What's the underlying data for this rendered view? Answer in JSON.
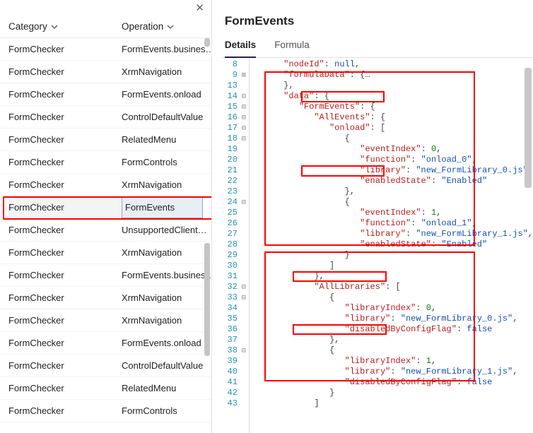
{
  "right_title": "FormEvents",
  "tabs": {
    "details": "Details",
    "formula": "Formula",
    "active": "details"
  },
  "headers": {
    "category": "Category",
    "operation": "Operation"
  },
  "rows": [
    {
      "cat": "FormChecker",
      "op": "FormEvents.busines…"
    },
    {
      "cat": "FormChecker",
      "op": "XrmNavigation"
    },
    {
      "cat": "FormChecker",
      "op": "FormEvents.onload"
    },
    {
      "cat": "FormChecker",
      "op": "ControlDefaultValue"
    },
    {
      "cat": "FormChecker",
      "op": "RelatedMenu"
    },
    {
      "cat": "FormChecker",
      "op": "FormControls"
    },
    {
      "cat": "FormChecker",
      "op": "XrmNavigation"
    },
    {
      "cat": "FormChecker",
      "op": "FormEvents",
      "selected": true
    },
    {
      "cat": "FormChecker",
      "op": "UnsupportedClient…"
    },
    {
      "cat": "FormChecker",
      "op": "XrmNavigation"
    },
    {
      "cat": "FormChecker",
      "op": "FormEvents.busines…"
    },
    {
      "cat": "FormChecker",
      "op": "XrmNavigation"
    },
    {
      "cat": "FormChecker",
      "op": "XrmNavigation"
    },
    {
      "cat": "FormChecker",
      "op": "FormEvents.onload"
    },
    {
      "cat": "FormChecker",
      "op": "ControlDefaultValue"
    },
    {
      "cat": "FormChecker",
      "op": "RelatedMenu"
    },
    {
      "cat": "FormChecker",
      "op": "FormControls"
    }
  ],
  "code_lines": [
    {
      "n": 8,
      "g": "",
      "indent": 2,
      "tokens": [
        [
          "k",
          "\"nodeId\""
        ],
        [
          "p",
          ": "
        ],
        [
          "nullv",
          "null"
        ],
        [
          "p",
          ","
        ]
      ]
    },
    {
      "n": 9,
      "g": "+",
      "indent": 2,
      "tokens": [
        [
          "k",
          "\"formulaData\""
        ],
        [
          "p",
          ": {"
        ],
        [
          "p",
          "…"
        ]
      ]
    },
    {
      "n": 13,
      "g": "",
      "indent": 2,
      "tokens": [
        [
          "p",
          "},"
        ]
      ]
    },
    {
      "n": 14,
      "g": "-",
      "indent": 2,
      "tokens": [
        [
          "k",
          "\"data\""
        ],
        [
          "p",
          ": {"
        ]
      ]
    },
    {
      "n": 15,
      "g": "-",
      "indent": 3,
      "tokens": [
        [
          "k",
          "\"FormEvents\""
        ],
        [
          "p",
          ": {"
        ]
      ]
    },
    {
      "n": 16,
      "g": "-",
      "indent": 4,
      "tokens": [
        [
          "k",
          "\"AllEvents\""
        ],
        [
          "p",
          ": {"
        ]
      ]
    },
    {
      "n": 17,
      "g": "-",
      "indent": 5,
      "tokens": [
        [
          "k",
          "\"onload\""
        ],
        [
          "p",
          ": ["
        ]
      ]
    },
    {
      "n": 18,
      "g": "-",
      "indent": 6,
      "tokens": [
        [
          "p",
          "{"
        ]
      ]
    },
    {
      "n": 19,
      "g": "",
      "indent": 7,
      "tokens": [
        [
          "k",
          "\"eventIndex\""
        ],
        [
          "p",
          ": "
        ],
        [
          "n",
          "0"
        ],
        [
          "p",
          ","
        ]
      ]
    },
    {
      "n": 20,
      "g": "",
      "indent": 7,
      "tokens": [
        [
          "k",
          "\"function\""
        ],
        [
          "p",
          ": "
        ],
        [
          "s",
          "\"onload_0\""
        ],
        [
          "p",
          ","
        ]
      ]
    },
    {
      "n": 21,
      "g": "",
      "indent": 7,
      "tokens": [
        [
          "k",
          "\"library\""
        ],
        [
          "p",
          ": "
        ],
        [
          "s",
          "\"new_FormLibrary_0.js\""
        ],
        [
          "p",
          ","
        ]
      ]
    },
    {
      "n": 22,
      "g": "",
      "indent": 7,
      "tokens": [
        [
          "k",
          "\"enabledState\""
        ],
        [
          "p",
          ": "
        ],
        [
          "s",
          "\"Enabled\""
        ]
      ]
    },
    {
      "n": 23,
      "g": "",
      "indent": 6,
      "tokens": [
        [
          "p",
          "},"
        ]
      ]
    },
    {
      "n": 24,
      "g": "-",
      "indent": 6,
      "tokens": [
        [
          "p",
          "{"
        ]
      ]
    },
    {
      "n": 25,
      "g": "",
      "indent": 7,
      "tokens": [
        [
          "k",
          "\"eventIndex\""
        ],
        [
          "p",
          ": "
        ],
        [
          "n",
          "1"
        ],
        [
          "p",
          ","
        ]
      ]
    },
    {
      "n": 26,
      "g": "",
      "indent": 7,
      "tokens": [
        [
          "k",
          "\"function\""
        ],
        [
          "p",
          ": "
        ],
        [
          "s",
          "\"onload_1\""
        ],
        [
          "p",
          ","
        ]
      ]
    },
    {
      "n": 27,
      "g": "",
      "indent": 7,
      "tokens": [
        [
          "k",
          "\"library\""
        ],
        [
          "p",
          ": "
        ],
        [
          "s",
          "\"new_FormLibrary_1.js\""
        ],
        [
          "p",
          ","
        ]
      ]
    },
    {
      "n": 28,
      "g": "",
      "indent": 7,
      "tokens": [
        [
          "k",
          "\"enabledState\""
        ],
        [
          "p",
          ": "
        ],
        [
          "s",
          "\"Enabled\""
        ]
      ]
    },
    {
      "n": 29,
      "g": "",
      "indent": 6,
      "tokens": [
        [
          "p",
          "}"
        ]
      ]
    },
    {
      "n": 30,
      "g": "",
      "indent": 5,
      "tokens": [
        [
          "p",
          "]"
        ]
      ]
    },
    {
      "n": 31,
      "g": "",
      "indent": 4,
      "tokens": [
        [
          "p",
          "},"
        ]
      ]
    },
    {
      "n": 32,
      "g": "-",
      "indent": 4,
      "tokens": [
        [
          "k",
          "\"AllLibraries\""
        ],
        [
          "p",
          ": ["
        ]
      ]
    },
    {
      "n": 33,
      "g": "-",
      "indent": 5,
      "tokens": [
        [
          "p",
          "{"
        ]
      ]
    },
    {
      "n": 34,
      "g": "",
      "indent": 6,
      "tokens": [
        [
          "k",
          "\"libraryIndex\""
        ],
        [
          "p",
          ": "
        ],
        [
          "n",
          "0"
        ],
        [
          "p",
          ","
        ]
      ]
    },
    {
      "n": 35,
      "g": "",
      "indent": 6,
      "tokens": [
        [
          "k",
          "\"library\""
        ],
        [
          "p",
          ": "
        ],
        [
          "s",
          "\"new_FormLibrary_0.js\""
        ],
        [
          "p",
          ","
        ]
      ]
    },
    {
      "n": 36,
      "g": "",
      "indent": 6,
      "tokens": [
        [
          "k",
          "\"disabledByConfigFlag\""
        ],
        [
          "p",
          ": "
        ],
        [
          "b",
          "false"
        ]
      ]
    },
    {
      "n": 37,
      "g": "",
      "indent": 5,
      "tokens": [
        [
          "p",
          "},"
        ]
      ]
    },
    {
      "n": 38,
      "g": "-",
      "indent": 5,
      "tokens": [
        [
          "p",
          "{"
        ]
      ]
    },
    {
      "n": 39,
      "g": "",
      "indent": 6,
      "tokens": [
        [
          "k",
          "\"libraryIndex\""
        ],
        [
          "p",
          ": "
        ],
        [
          "n",
          "1"
        ],
        [
          "p",
          ","
        ]
      ]
    },
    {
      "n": 40,
      "g": "",
      "indent": 6,
      "tokens": [
        [
          "k",
          "\"library\""
        ],
        [
          "p",
          ": "
        ],
        [
          "s",
          "\"new_FormLibrary_1.js\""
        ],
        [
          "p",
          ","
        ]
      ]
    },
    {
      "n": 41,
      "g": "",
      "indent": 6,
      "tokens": [
        [
          "k",
          "\"disabledByConfigFlag\""
        ],
        [
          "p",
          ": "
        ],
        [
          "b",
          "false"
        ]
      ]
    },
    {
      "n": 42,
      "g": "",
      "indent": 5,
      "tokens": [
        [
          "p",
          "}"
        ]
      ]
    },
    {
      "n": 43,
      "g": "",
      "indent": 4,
      "tokens": [
        [
          "p",
          "]"
        ]
      ]
    }
  ]
}
